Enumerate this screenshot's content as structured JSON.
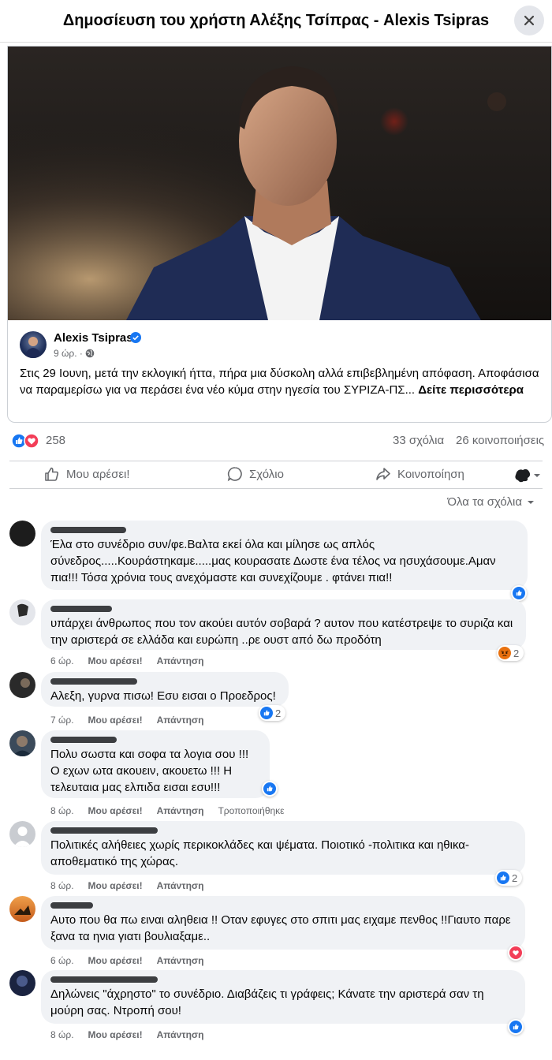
{
  "header": {
    "title": "Δημοσίευση του χρήστη Αλέξης Τσίπρας - Alexis Tsipras"
  },
  "post": {
    "author": "Alexis Tsipras",
    "time": "9 ώρ. ·",
    "text": "Στις 29 Ιουνη, μετά την εκλογική ήττα, πήρα μια δύσκολη αλλά επιβεβλημένη απόφαση. Αποφάσισα να παραμερίσω για να περάσει ένα νέο κύμα στην ηγεσία του ΣΥΡΙΖΑ-ΠΣ...",
    "see_more": "Δείτε περισσότερα"
  },
  "stats": {
    "reactions": "258",
    "comments": "33 σχόλια",
    "shares": "26 κοινοποιήσεις"
  },
  "actions": {
    "like": "Μου αρέσει!",
    "comment": "Σχόλιο",
    "share": "Κοινοποίηση"
  },
  "sort": {
    "label": "Όλα τα σχόλια"
  },
  "comment_labels": {
    "like": "Μου αρέσει!",
    "reply": "Απάντηση",
    "edited": "Τροποποιήθηκε"
  },
  "comments": [
    {
      "text": "Έλα στο συνέδριο συν/φε.Βαλτα εκεί όλα και μίλησε ως απλός σύνεδρος.....Κουράστηκαμε.....μας κουρασατε Δωστε ένα τέλος να ησυχάσουμε.Αμαν πια!!! Τόσα χρόνια τους ανεχόμαστε και συνεχίζουμε . φτάνει πια!!",
      "time": "",
      "reaction_count": ""
    },
    {
      "text": "υπάρχει άνθρωπος που τον ακούει αυτόν σοβαρά ? αυτον που κατέστρεψε το συριζα και την αριστερά σε ελλάδα και ευρώπη ..ρε ουστ από δω προδότη",
      "time": "6 ώρ.",
      "reaction_count": "2"
    },
    {
      "text": "Αλεξη, γυρνα πισω! Εσυ εισαι ο Προεδρος!",
      "time": "7 ώρ.",
      "reaction_count": "2"
    },
    {
      "text": "Πολυ σωστα και σοφα τα λογια σου !!! Ο εχων ωτα ακουειν, ακουετω !!! Η τελευταια μας ελπιδα εισαι εσυ!!!",
      "time": "8 ώρ.",
      "reaction_count": ""
    },
    {
      "text": "Πολιτικές αλήθειες χωρίς περικοκλάδες και ψέματα. Ποιοτικό -πολιτικα και ηθικα- αποθεματικό της χώρας.",
      "time": "8 ώρ.",
      "reaction_count": "2"
    },
    {
      "text": "Αυτο που θα πω ειναι αληθεια !! Οταν εφυγες στο σπιτι μας ειχαμε πενθος !!Γιαυτο παρε ξανα τα ηνια γιατι βουλιαξαμε..",
      "time": "6 ώρ.",
      "reaction_count": ""
    },
    {
      "text": "Δηλώνεις \"άχρηστο\" το συνέδριο. Διαβάζεις τι γράφεις; Κάνατε την αριστερά σαν τη μούρη σας. Ντροπή σου!",
      "time": "8 ώρ.",
      "reaction_count": ""
    }
  ],
  "colors": {
    "like_blue": "#1877f2",
    "love_red": "#f33e58",
    "angry_orange": "#e9710f"
  }
}
